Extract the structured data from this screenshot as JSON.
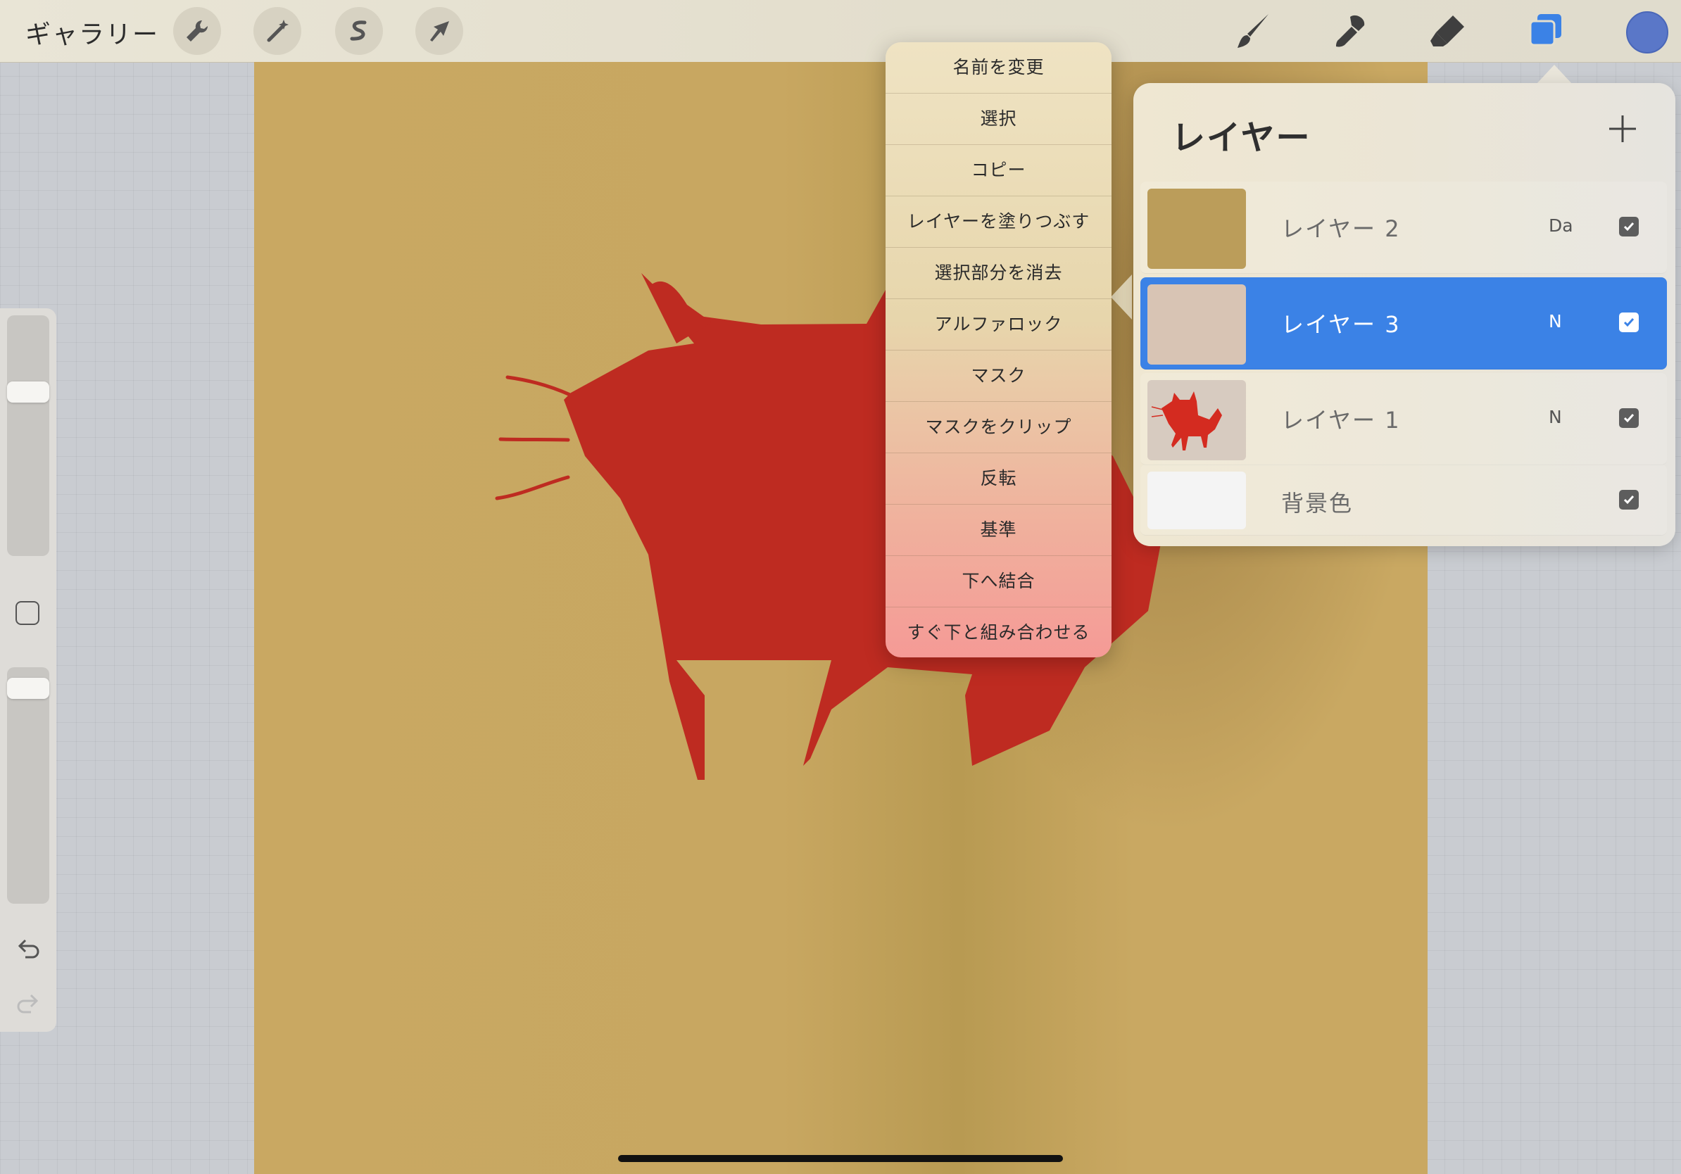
{
  "topbar": {
    "gallery_label": "ギャラリー",
    "left_tools": [
      "wrench-icon",
      "magic-wand-icon",
      "selection-icon",
      "transform-arrow-icon"
    ],
    "right_tools": [
      "brush-icon",
      "smudge-icon",
      "eraser-icon",
      "layers-icon",
      "color-swatch"
    ],
    "active_tool": "layers-icon",
    "current_color": "#5a77c8"
  },
  "sidebar": {
    "brush_size_level": 0.3,
    "opacity_level": 0.05,
    "icons": [
      "modify-square-icon",
      "undo-icon",
      "redo-icon"
    ]
  },
  "context_menu": {
    "items": [
      "名前を変更",
      "選択",
      "コピー",
      "レイヤーを塗りつぶす",
      "選択部分を消去",
      "アルファロック",
      "マスク",
      "マスクをクリップ",
      "反転",
      "基準",
      "下へ結合",
      "すぐ下と組み合わせる"
    ]
  },
  "layers_panel": {
    "title": "レイヤー",
    "add_label": "+",
    "layers": [
      {
        "name": "レイヤー 2",
        "blend": "Da",
        "visible": true,
        "active": false,
        "thumb": "#bb9d5a"
      },
      {
        "name": "レイヤー 3",
        "blend": "N",
        "visible": true,
        "active": true,
        "thumb": "#d8c4b4"
      },
      {
        "name": "レイヤー 1",
        "blend": "N",
        "visible": true,
        "active": false,
        "thumb": "#d7cbc0"
      },
      {
        "name": "背景色",
        "blend": "",
        "visible": true,
        "active": false,
        "thumb": "#f4f4f4"
      }
    ]
  },
  "colors": {
    "canvas": "#c9a862",
    "cat": "#be2b21",
    "accent": "#3b82e6"
  }
}
